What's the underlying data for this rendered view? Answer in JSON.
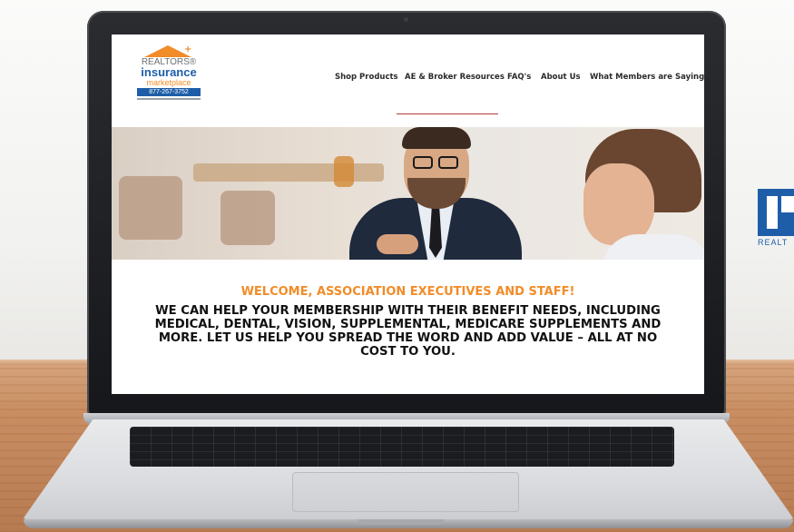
{
  "site": {
    "logo": {
      "line1": "REALTORS®",
      "line2": "insurance",
      "line3": "marketplace",
      "phone": "877-267-3752"
    },
    "nav": {
      "items": [
        {
          "label": "Shop Products"
        },
        {
          "label": "AE & Broker Resources"
        },
        {
          "label": "FAQ's"
        },
        {
          "label": "About Us"
        },
        {
          "label": "What Members are Saying"
        }
      ]
    },
    "welcome": {
      "heading": "WELCOME, ASSOCIATION EXECUTIVES AND STAFF!",
      "body_lines": [
        "WE CAN HELP YOUR MEMBERSHIP WITH THEIR BENEFIT NEEDS, INCLUDING",
        "MEDICAL, DENTAL, VISION, SUPPLEMENTAL, MEDICARE SUPPLEMENTS AND",
        "MORE. LET US HELP YOU SPREAD THE WORD AND ADD VALUE – ALL AT NO",
        "COST TO YOU."
      ]
    }
  },
  "background": {
    "side_logo_text": "REALT"
  },
  "colors": {
    "brand_orange": "#f28c28",
    "brand_blue": "#1e5ea8",
    "nav_underline": "#b23a3a"
  }
}
